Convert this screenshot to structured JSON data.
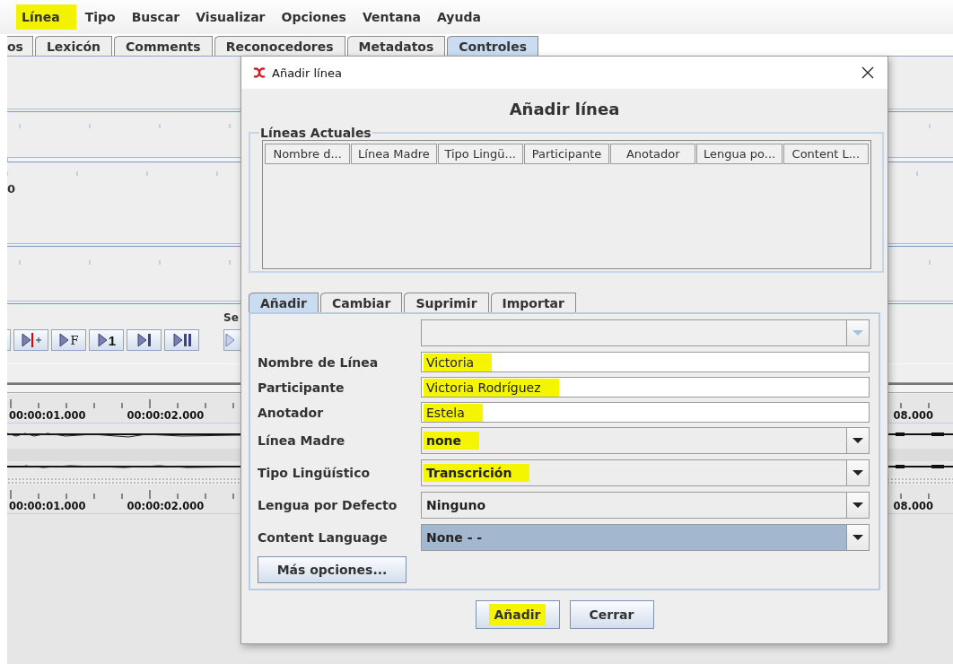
{
  "menu_bar": [
    {
      "label": "Línea",
      "highlighted": true
    },
    {
      "label": "Tipo",
      "highlighted": false
    },
    {
      "label": "Buscar",
      "highlighted": false
    },
    {
      "label": "Visualizar",
      "highlighted": false
    },
    {
      "label": "Opciones",
      "highlighted": false
    },
    {
      "label": "Ventana",
      "highlighted": false
    },
    {
      "label": "Ayuda",
      "highlighted": false
    }
  ],
  "tabs": [
    {
      "label": "os",
      "selected": false
    },
    {
      "label": "Lexicón",
      "selected": false
    },
    {
      "label": "Comments",
      "selected": false
    },
    {
      "label": "Reconocedores",
      "selected": false
    },
    {
      "label": "Metadatos",
      "selected": false
    },
    {
      "label": "Controles",
      "selected": true
    }
  ],
  "track_label": "0",
  "selection_label": "Se",
  "player_buttons": [
    {
      "kind": "blank"
    },
    {
      "kind": "mark"
    },
    {
      "kind": "text",
      "label": "F"
    },
    {
      "kind": "text",
      "label": "1"
    },
    {
      "kind": "next"
    },
    {
      "kind": "pause"
    },
    {
      "kind": "play"
    }
  ],
  "timelines": [
    {
      "labels": [
        "00:00:01.000",
        "00:00:02.000"
      ],
      "right_label": "08.000"
    },
    {
      "labels": [
        "00:00:01.000",
        "00:00:02.000"
      ],
      "right_label": "08.000"
    }
  ],
  "dialog": {
    "title": "Añadir línea",
    "heading": "Añadir línea",
    "group_title": "Líneas Actuales",
    "columns": [
      "Nombre d...",
      "Línea Madre",
      "Tipo Lingü...",
      "Participante",
      "Anotador",
      "Lengua po...",
      "Content L..."
    ],
    "tabs": [
      {
        "label": "Añadir",
        "selected": true
      },
      {
        "label": "Cambiar",
        "selected": false
      },
      {
        "label": "Suprimir",
        "selected": false
      },
      {
        "label": "Importar",
        "selected": false
      }
    ],
    "fields": [
      {
        "kind": "combo",
        "disabled": true,
        "focused": false
      },
      {
        "kind": "text",
        "label": "Nombre de Línea",
        "value": "Victoria",
        "highlighted": true
      },
      {
        "kind": "text",
        "label": "Participante",
        "value": "Victoria Rodríguez",
        "highlighted": true
      },
      {
        "kind": "text",
        "label": "Anotador",
        "value": "Estela",
        "highlighted": true
      },
      {
        "kind": "combo",
        "label": "Línea Madre",
        "value": "none",
        "disabled": false,
        "focused": false,
        "highlighted": true
      },
      {
        "kind": "combo",
        "label": "Tipo Lingüístico",
        "value": "Transcrición",
        "disabled": false,
        "focused": false,
        "highlighted": true
      },
      {
        "kind": "combo",
        "label": "Lengua por Defecto",
        "value": "Ninguno",
        "disabled": false,
        "focused": false,
        "highlighted": false
      },
      {
        "kind": "combo",
        "label": "Content Language",
        "value": "None -  -",
        "disabled": false,
        "focused": true,
        "highlighted": false
      }
    ],
    "more_button": "Más opciones...",
    "buttons": [
      {
        "label": "Añadir",
        "highlighted": true
      },
      {
        "label": "Cerrar",
        "highlighted": false
      }
    ]
  }
}
